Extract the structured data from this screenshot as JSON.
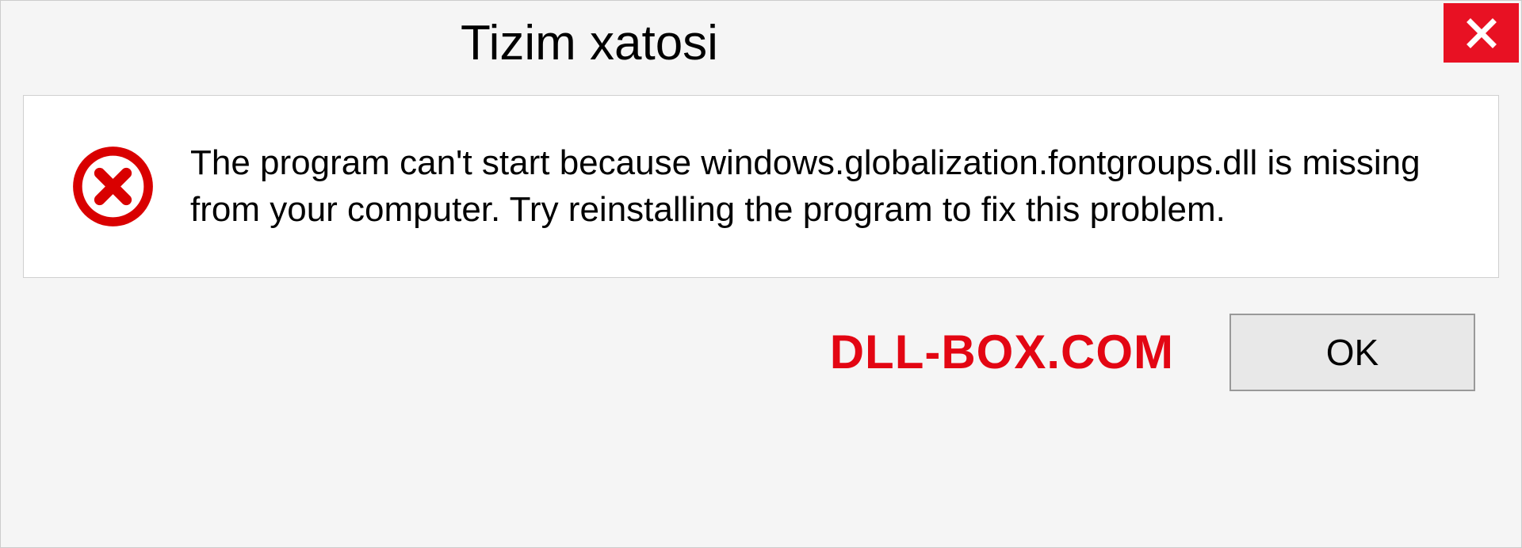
{
  "dialog": {
    "title": "Tizim xatosi",
    "message": "The program can't start because windows.globalization.fontgroups.dll is missing from your computer. Try reinstalling the program to fix this problem.",
    "ok_label": "OK"
  },
  "watermark": "DLL-BOX.COM"
}
